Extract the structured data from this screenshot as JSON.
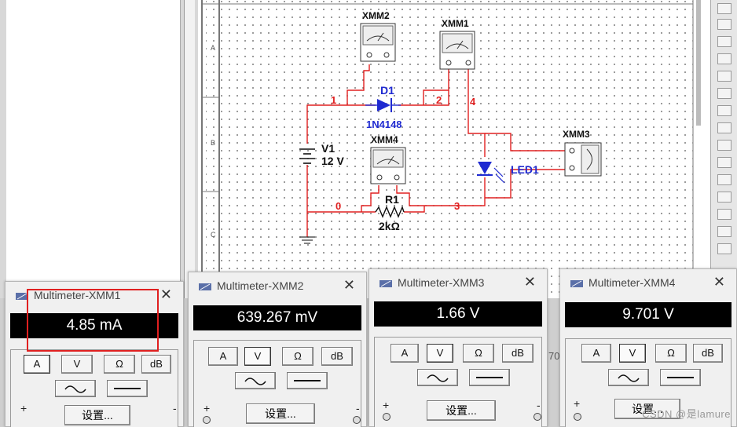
{
  "schematic": {
    "components": {
      "xmm1": "XMM1",
      "xmm2": "XMM2",
      "xmm3": "XMM3",
      "xmm4": "XMM4",
      "d1_ref": "D1",
      "d1_part": "1N4148",
      "v1_ref": "V1",
      "v1_value": "12 V",
      "r1_ref": "R1",
      "r1_value": "2kΩ",
      "led_ref": "LED1"
    },
    "nodes": [
      "1",
      "2",
      "4",
      "0",
      "3"
    ],
    "row_labels": [
      "A",
      "B",
      "C"
    ],
    "colors": {
      "wire": "#e02020",
      "component": "#1f2ad1",
      "instrument": "#2a6a2a"
    }
  },
  "multimeters": [
    {
      "title": "Multimeter-XMM1",
      "reading": "4.85 mA",
      "selected": "A"
    },
    {
      "title": "Multimeter-XMM2",
      "reading": "639.267 mV",
      "selected": "V"
    },
    {
      "title": "Multimeter-XMM3",
      "reading": "1.66 V",
      "selected": "V"
    },
    {
      "title": "Multimeter-XMM4",
      "reading": "9.701 V",
      "selected": "V"
    }
  ],
  "buttons": {
    "a": "A",
    "v": "V",
    "ohm": "Ω",
    "db": "dB",
    "settings": "设置...",
    "plus": "+",
    "minus": "-"
  },
  "partial_text": "70",
  "watermark": "CSDN @是lamure",
  "highlight_color": "#e02020"
}
